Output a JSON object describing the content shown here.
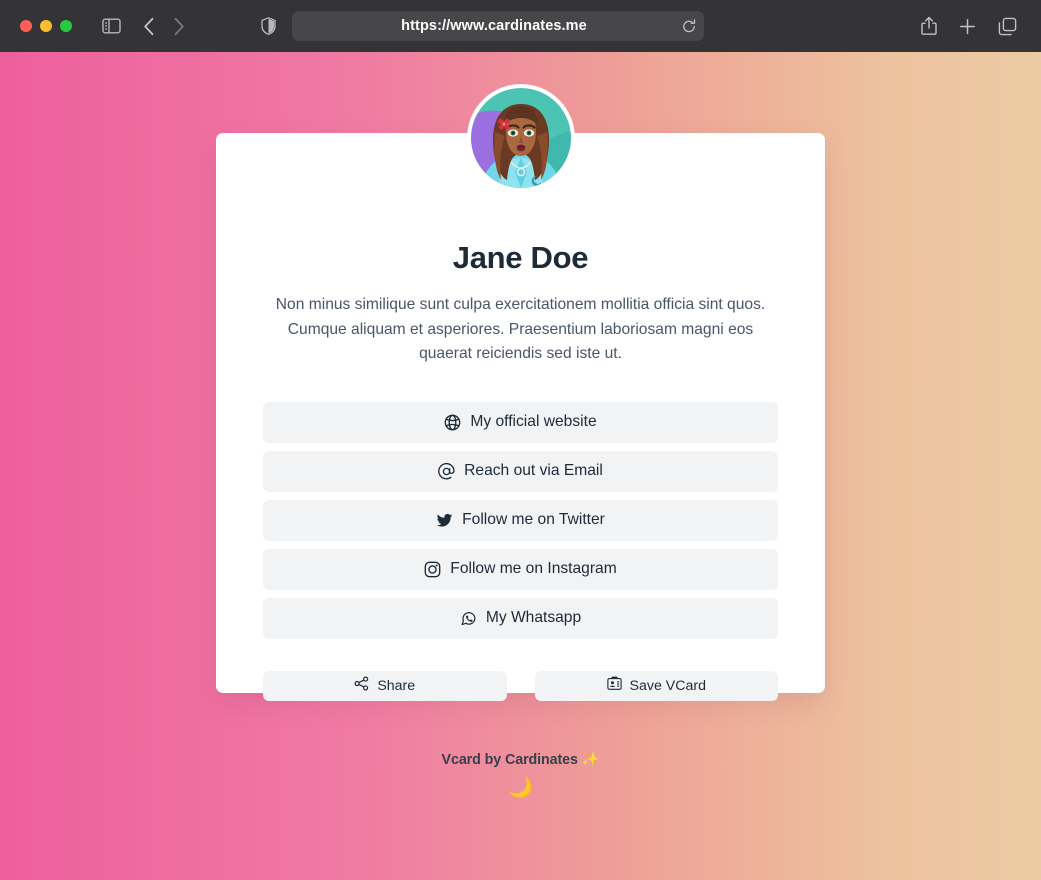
{
  "browser": {
    "url": "https://www.cardinates.me",
    "traffic_lights": [
      "close-red",
      "minimize-yellow",
      "maximize-green"
    ],
    "icons": {
      "sidebar": "sidebar-toggle-icon",
      "back": "back-arrow-icon",
      "forward": "forward-arrow-icon",
      "shield": "privacy-shield-icon",
      "reload": "reload-icon",
      "share": "share-icon",
      "new_tab": "plus-icon",
      "tabs": "tab-overview-icon"
    }
  },
  "profile": {
    "avatar_alt": "illustrated-portrait-woman-with-flower",
    "name": "Jane Doe",
    "bio": "Non minus similique sunt culpa exercitationem mollitia officia sint quos. Cumque aliquam et asperiores. Praesentium laboriosam magni eos quaerat reiciendis sed iste ut."
  },
  "links": [
    {
      "label": "My official website",
      "icon": "globe-icon"
    },
    {
      "label": "Reach out via Email",
      "icon": "at-sign-icon"
    },
    {
      "label": "Follow me on Twitter",
      "icon": "twitter-icon"
    },
    {
      "label": "Follow me on Instagram",
      "icon": "instagram-icon"
    },
    {
      "label": "My Whatsapp",
      "icon": "whatsapp-icon"
    }
  ],
  "actions": [
    {
      "label": "Share",
      "icon": "share-nodes-icon"
    },
    {
      "label": "Save VCard",
      "icon": "contact-card-icon"
    }
  ],
  "footer": {
    "text": "Vcard by Cardinates ✨",
    "moon": "🌙"
  },
  "colors": {
    "gradient_start": "#ee5f9d",
    "gradient_end": "#ebcba3",
    "card_bg": "#ffffff",
    "button_bg": "#f1f3f5",
    "text_dark": "#1f2a37",
    "text_muted": "#4a5568",
    "toolbar_bg": "#343437"
  }
}
